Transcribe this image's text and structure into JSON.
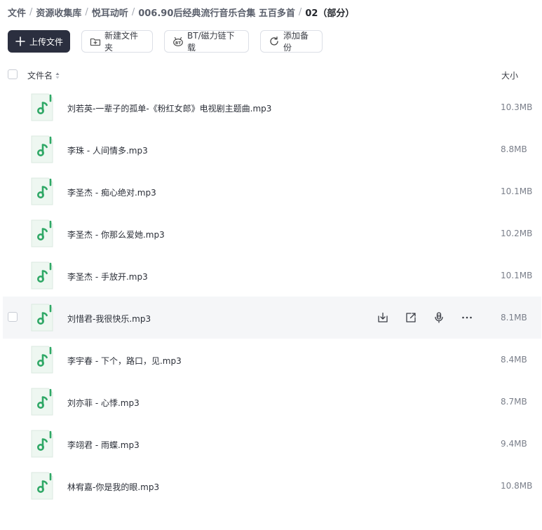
{
  "breadcrumb": [
    {
      "label": "文件"
    },
    {
      "label": "资源收集库"
    },
    {
      "label": "悦耳动听"
    },
    {
      "label": "006.90后经典流行音乐合集 五百多首"
    },
    {
      "label": "02（部分）"
    }
  ],
  "breadcrumb_separator": "/",
  "toolbar": {
    "upload": "上传文件",
    "new_folder": "新建文件夹",
    "bt_download": "BT/磁力链下载",
    "add_backup": "添加备份"
  },
  "list_header": {
    "name": "文件名",
    "size": "大小"
  },
  "files": [
    {
      "name": "刘若英-一辈子的孤单-《粉红女郎》电视剧主题曲.mp3",
      "size": "10.3MB"
    },
    {
      "name": "李珠 - 人间情多.mp3",
      "size": "8.8MB"
    },
    {
      "name": "李圣杰 - 痴心绝对.mp3",
      "size": "10.1MB"
    },
    {
      "name": "李圣杰 - 你那么爱她.mp3",
      "size": "10.2MB"
    },
    {
      "name": "李圣杰 - 手放开.mp3",
      "size": "10.1MB"
    },
    {
      "name": "刘惜君-我很快乐.mp3",
      "size": "8.1MB"
    },
    {
      "name": "李宇春 - 下个，路口，见.mp3",
      "size": "8.4MB"
    },
    {
      "name": "刘亦菲 - 心悸.mp3",
      "size": "8.7MB"
    },
    {
      "name": "李翊君 - 雨蝶.mp3",
      "size": "9.4MB"
    },
    {
      "name": "林宥嘉-你是我的眼.mp3",
      "size": "10.8MB"
    }
  ],
  "hovered_row": 5,
  "colors": {
    "primary_button": "#2b2f3f",
    "music_icon": "#2fa866",
    "hover_row": "#f5f6f8"
  }
}
